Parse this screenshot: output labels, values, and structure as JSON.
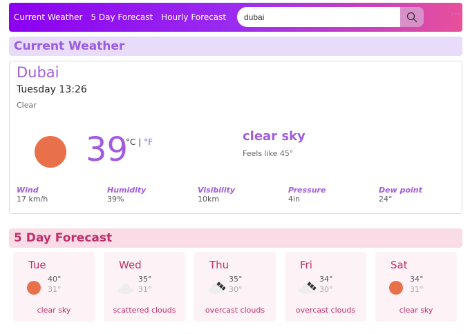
{
  "nav": {
    "links": [
      "Current Weather",
      "5 Day Forecast",
      "Hourly Forecast"
    ],
    "search_value": "dubai"
  },
  "current": {
    "section_title": "Current Weather",
    "city": "Dubai",
    "datetime": "Tuesday 13:26",
    "condition": "Clear",
    "temp": "39",
    "unit_c": "°C",
    "unit_sep": " | ",
    "unit_f": "°F",
    "description": "clear sky",
    "feels_like": "Feels like 45°",
    "stats": [
      {
        "label": "Wind",
        "value": "17 km/h"
      },
      {
        "label": "Humidity",
        "value": "39%"
      },
      {
        "label": "Visibility",
        "value": "10km"
      },
      {
        "label": "Pressure",
        "value": "4in"
      },
      {
        "label": "Dew point",
        "value": "24°"
      }
    ]
  },
  "forecast": {
    "section_title": "5 Day Forecast",
    "days": [
      {
        "day": "Tue",
        "high": "40°",
        "low": "31°",
        "desc": "clear sky",
        "icon": "sun"
      },
      {
        "day": "Wed",
        "high": "35°",
        "low": "31°",
        "desc": "scattered clouds",
        "icon": "cloud"
      },
      {
        "day": "Thu",
        "high": "35°",
        "low": "30°",
        "desc": "overcast clouds",
        "icon": "overcast"
      },
      {
        "day": "Fri",
        "high": "34°",
        "low": "30°",
        "desc": "overcast clouds",
        "icon": "overcast"
      },
      {
        "day": "Sat",
        "high": "34°",
        "low": "31°",
        "desc": "clear sky",
        "icon": "sun"
      }
    ]
  }
}
